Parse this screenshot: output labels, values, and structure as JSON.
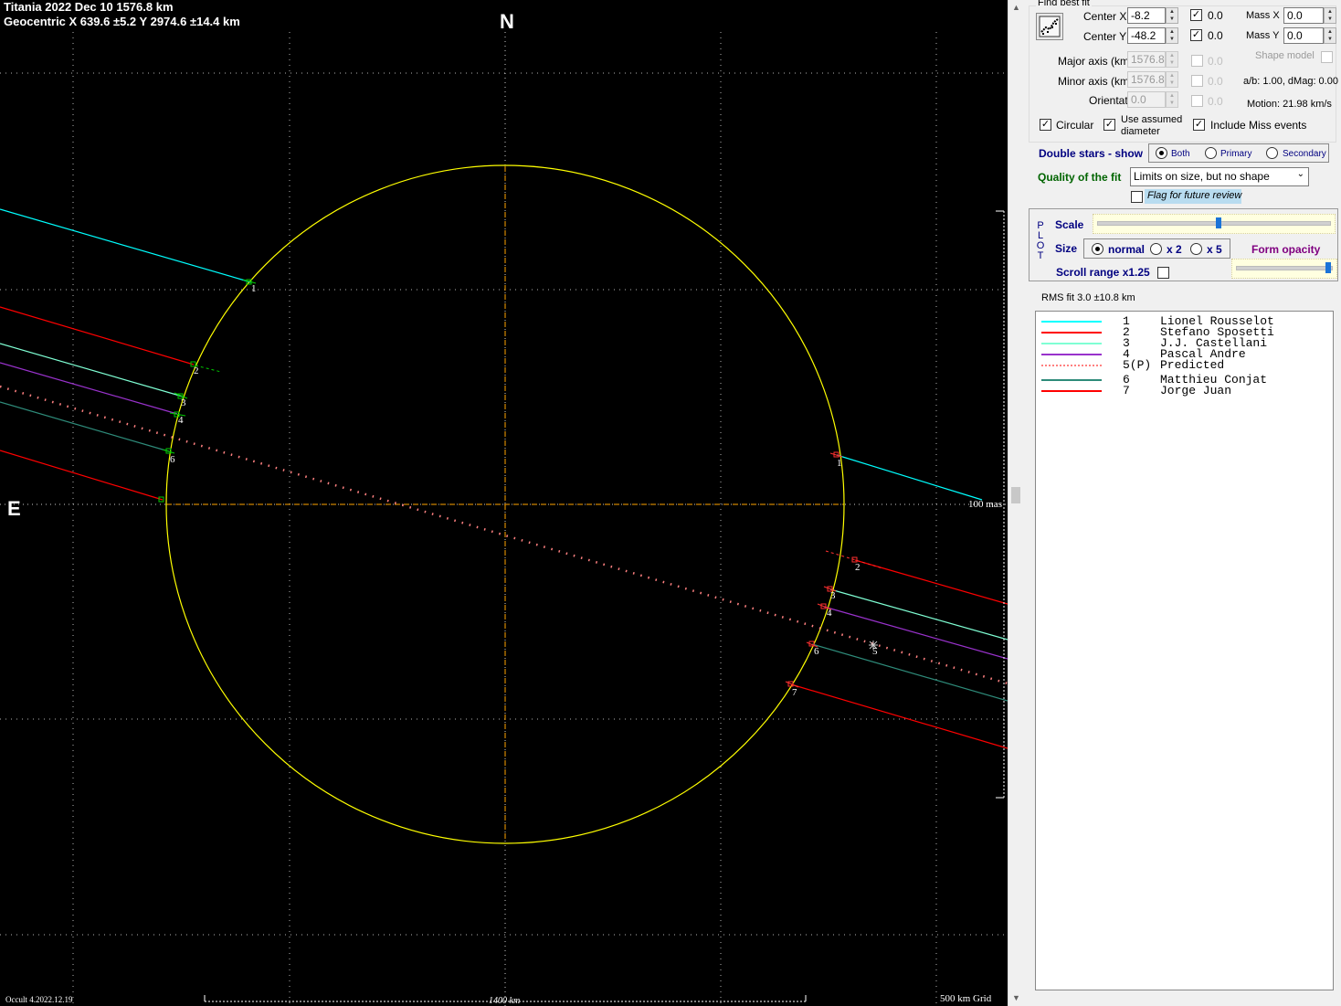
{
  "plot": {
    "title_line1": "Titania  2022 Dec 10   1576.8 km",
    "title_line2": "Geocentric  X  639.6 ±5.2  Y 2974.6 ±14.4 km",
    "north_label": "N",
    "east_label": "E",
    "angular_scale_label": "100 mas",
    "version_label": "Occult 4.2022.12.19",
    "scale_bar_label": "1400 km",
    "grid_label": "500 km Grid",
    "colors": {
      "background": "#000000",
      "limb": "#ffff00",
      "axes": "#ffa500",
      "grid": "#ffffff"
    },
    "chords": [
      {
        "id": "1",
        "color": "#00ffff"
      },
      {
        "id": "2",
        "color": "#ff0000"
      },
      {
        "id": "3",
        "color": "#7fffd4"
      },
      {
        "id": "4",
        "color": "#9932cc"
      },
      {
        "id": "5",
        "color": "#ff8080",
        "style": "dotted"
      },
      {
        "id": "6",
        "color": "#2e8b7a"
      },
      {
        "id": "7",
        "color": "#ff0000"
      }
    ]
  },
  "panel": {
    "find_best_fit_label": "Find best fit",
    "center_x_label": "Center X",
    "center_x_value": "-8.2",
    "center_y_label": "Center Y",
    "center_y_value": "-48.2",
    "center_x_check": "0.0",
    "center_y_check": "0.0",
    "mass_x_label": "Mass X",
    "mass_x_value": "0.0",
    "mass_y_label": "Mass Y",
    "mass_y_value": "0.0",
    "shape_model_label": "Shape model",
    "major_axis_label": "Major axis (km)",
    "major_axis_value": "1576.8",
    "major_axis_check": "0.0",
    "minor_axis_label": "Minor axis (km)",
    "minor_axis_value": "1576.8",
    "minor_axis_check": "0.0",
    "orientation_label": "Orientation",
    "orientation_value": "0.0",
    "orientation_check": "0.0",
    "ab_dmag_label": "a/b: 1.00, dMag: 0.00",
    "motion_label": "Motion: 21.98 km/s",
    "circular_label": "Circular",
    "use_assumed_label_1": "Use assumed",
    "use_assumed_label_2": "diameter",
    "include_miss_label": "Include Miss events",
    "double_stars_label": "Double stars - show",
    "double_both": "Both",
    "double_primary": "Primary",
    "double_secondary": "Secondary",
    "quality_label": "Quality of the fit",
    "quality_value": "Limits on size, but no shape",
    "flag_review_label": "Flag for future review",
    "plot_vertical": [
      "P",
      "L",
      "O",
      "T"
    ],
    "scale_label": "Scale",
    "size_label": "Size",
    "size_normal": "normal",
    "size_x2": "x 2",
    "size_x5": "x 5",
    "form_opacity_label": "Form opacity",
    "scroll_range_label": "Scroll range x1.25",
    "scale_level": 0.52,
    "opacity_level": 0.98,
    "rms_label": "RMS fit 3.0 ±10.8 km",
    "legend": [
      {
        "num": "1",
        "name": "Lionel Rousselot",
        "color": "#00ffff",
        "style": "solid"
      },
      {
        "num": "2",
        "name": "Stefano Sposetti",
        "color": "#ff0000",
        "style": "solid"
      },
      {
        "num": "3",
        "name": "J.J. Castellani",
        "color": "#7fffd4",
        "style": "solid"
      },
      {
        "num": "4",
        "name": "Pascal Andre",
        "color": "#9932cc",
        "style": "solid"
      },
      {
        "num": "5(P)",
        "name": "Predicted",
        "color": "#ff8080",
        "style": "dotted"
      },
      {
        "num": "6",
        "name": "Matthieu Conjat",
        "color": "#2e8b7a",
        "style": "solid"
      },
      {
        "num": "7",
        "name": "Jorge Juan",
        "color": "#ff0000",
        "style": "solid"
      }
    ]
  }
}
